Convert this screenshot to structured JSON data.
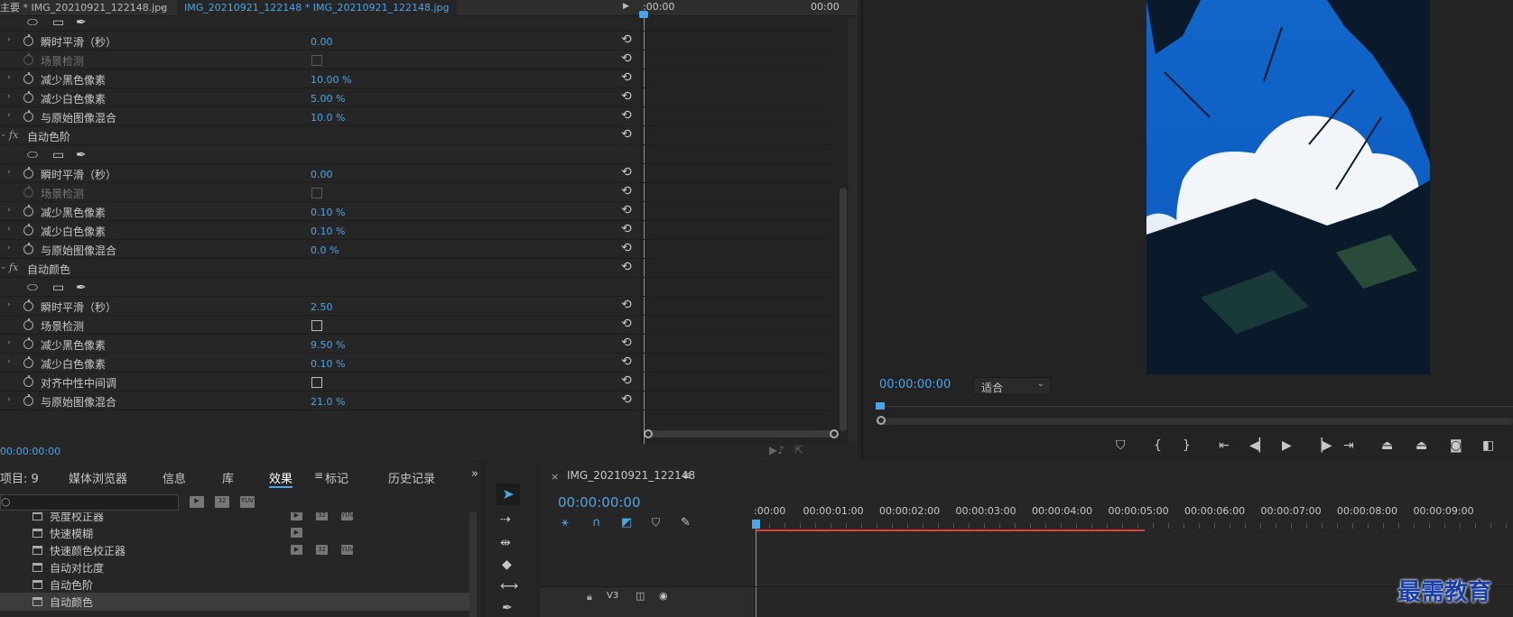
{
  "effect_controls": {
    "tabs": {
      "master": "主要 * IMG_20210921_122148.jpg",
      "clip": "IMG_20210921_122148 * IMG_20210921_122148.jpg"
    },
    "timecode_start": ":00:00",
    "timecode_end": "00:00",
    "bottom_timecode": "00:00:00:00",
    "rows": [
      {
        "type": "mask"
      },
      {
        "type": "prop",
        "label": "瞬时平滑（秒）",
        "value": "0.00",
        "dim": false
      },
      {
        "type": "check",
        "label": "场景检测",
        "dim": true
      },
      {
        "type": "prop",
        "label": "减少黑色像素",
        "value": "10.00 %",
        "dim": false
      },
      {
        "type": "prop",
        "label": "减少白色像素",
        "value": "5.00 %",
        "dim": false
      },
      {
        "type": "prop",
        "label": "与原始图像混合",
        "value": "10.0 %",
        "dim": false
      },
      {
        "type": "header",
        "label": "自动色阶"
      },
      {
        "type": "mask"
      },
      {
        "type": "prop",
        "label": "瞬时平滑（秒）",
        "value": "0.00",
        "dim": false
      },
      {
        "type": "check",
        "label": "场景检测",
        "dim": true
      },
      {
        "type": "prop",
        "label": "减少黑色像素",
        "value": "0.10 %",
        "dim": false
      },
      {
        "type": "prop",
        "label": "减少白色像素",
        "value": "0.10 %",
        "dim": false
      },
      {
        "type": "prop",
        "label": "与原始图像混合",
        "value": "0.0 %",
        "dim": false
      },
      {
        "type": "header",
        "label": "自动颜色"
      },
      {
        "type": "mask"
      },
      {
        "type": "prop",
        "label": "瞬时平滑（秒）",
        "value": "2.50",
        "dim": false
      },
      {
        "type": "check",
        "label": "场景检测",
        "dim": false,
        "twirl": false
      },
      {
        "type": "prop",
        "label": "减少黑色像素",
        "value": "9.50 %",
        "dim": false
      },
      {
        "type": "prop",
        "label": "减少白色像素",
        "value": "0.10 %",
        "dim": false
      },
      {
        "type": "check",
        "label": "对齐中性中间调",
        "dim": false,
        "twirl": false
      },
      {
        "type": "prop",
        "label": "与原始图像混合",
        "value": "21.0 %",
        "dim": false
      }
    ]
  },
  "program_monitor": {
    "timecode": "00:00:00:00",
    "fit_label": "适合",
    "accent": "#4aa6e8"
  },
  "project_panel": {
    "tabs": [
      "项目: 9",
      "媒体浏览器",
      "信息",
      "库",
      "效果",
      "标记",
      "历史记录"
    ],
    "active_tab": "效果",
    "items": [
      "亮度校正器",
      "快速模糊",
      "快速颜色校正器",
      "自动对比度",
      "自动色阶",
      "自动颜色"
    ]
  },
  "timeline": {
    "sequence_name": "IMG_20210921_122148",
    "timecode": "00:00:00:00",
    "ruler": [
      ":00:00",
      "00:00:01:00",
      "00:00:02:00",
      "00:00:03:00",
      "00:00:04:00",
      "00:00:05:00",
      "00:00:06:00",
      "00:00:07:00",
      "00:00:08:00",
      "00:00:09:00"
    ],
    "track": "V3",
    "playhead_color": "#4aa6e8",
    "work_area_color": "#e04040"
  },
  "watermark": "最需教育"
}
